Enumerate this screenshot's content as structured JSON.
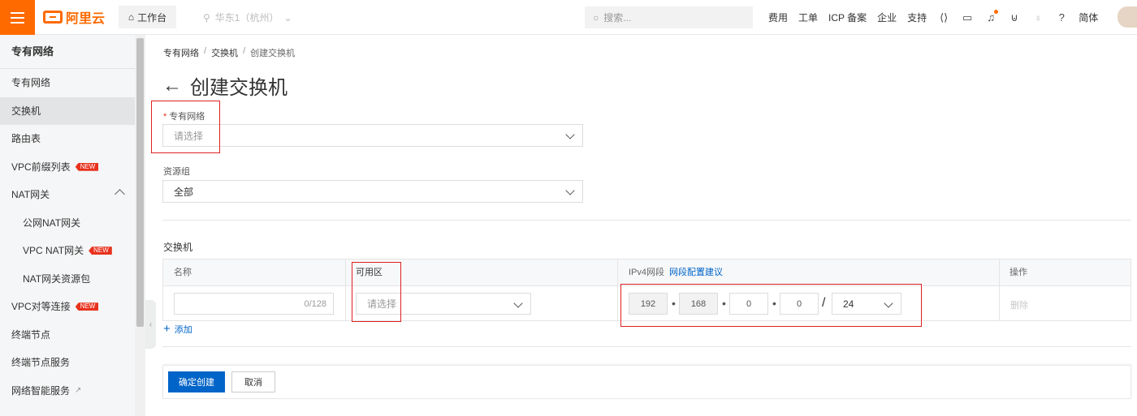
{
  "topbar": {
    "brand": "阿里云",
    "workbench": "工作台",
    "region": "华东1（杭州）",
    "search_placeholder": "搜索...",
    "links": [
      "费用",
      "工单",
      "ICP 备案",
      "企业",
      "支持"
    ],
    "language": "简体",
    "accent": "#ff6a00"
  },
  "sidebar": {
    "title": "专有网络",
    "items": [
      {
        "label": "专有网络"
      },
      {
        "label": "交换机"
      },
      {
        "label": "路由表"
      },
      {
        "label": "VPC前缀列表",
        "badge": "NEW"
      },
      {
        "label": "NAT网关"
      },
      {
        "label": "公网NAT网关"
      },
      {
        "label": "VPC NAT网关",
        "badge": "NEW"
      },
      {
        "label": "NAT网关资源包"
      },
      {
        "label": "VPC对等连接",
        "badge": "NEW"
      },
      {
        "label": "终端节点"
      },
      {
        "label": "终端节点服务"
      },
      {
        "label": "网络智能服务"
      }
    ]
  },
  "breadcrumb": [
    "专有网络",
    "交换机",
    "创建交换机"
  ],
  "page": {
    "title": "创建交换机",
    "vpc_label": "专有网络",
    "vpc_placeholder": "请选择",
    "rg_label": "资源组",
    "rg_value": "全部",
    "section_title": "交换机"
  },
  "table": {
    "headers": {
      "name": "名称",
      "zone": "可用区",
      "ipv4": "IPv4网段",
      "ipv4_link": "网段配置建议",
      "action": "操作"
    },
    "row": {
      "name_counter": "0/128",
      "zone_placeholder": "请选择",
      "ip": [
        "192",
        "168",
        "0",
        "0"
      ],
      "mask": "24",
      "delete": "删除"
    },
    "add": "添加"
  },
  "footer": {
    "confirm": "确定创建",
    "cancel": "取消"
  },
  "primary_color": "#0064c8",
  "highlight_color": "#e02020"
}
